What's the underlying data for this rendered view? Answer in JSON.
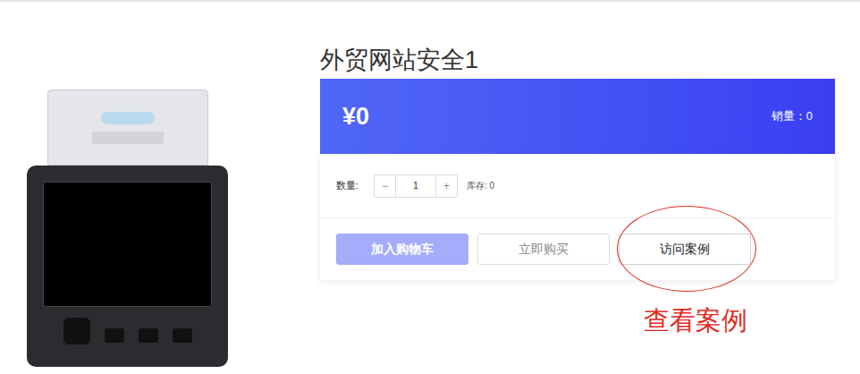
{
  "product": {
    "title": "外贸网站安全1",
    "price": "¥0",
    "sales": "销量：0"
  },
  "quantity": {
    "label": "数量:",
    "minus": "−",
    "value": "1",
    "plus": "+",
    "stock": "库存: 0"
  },
  "buttons": [
    {
      "label": "加入购物车",
      "kind": "primary",
      "disabled": true
    },
    {
      "label": "立即购买",
      "kind": "outline",
      "disabled": false
    },
    {
      "label": "访问案例",
      "kind": "outline-dark",
      "disabled": false
    }
  ],
  "annotation": {
    "text": "查看案例"
  }
}
